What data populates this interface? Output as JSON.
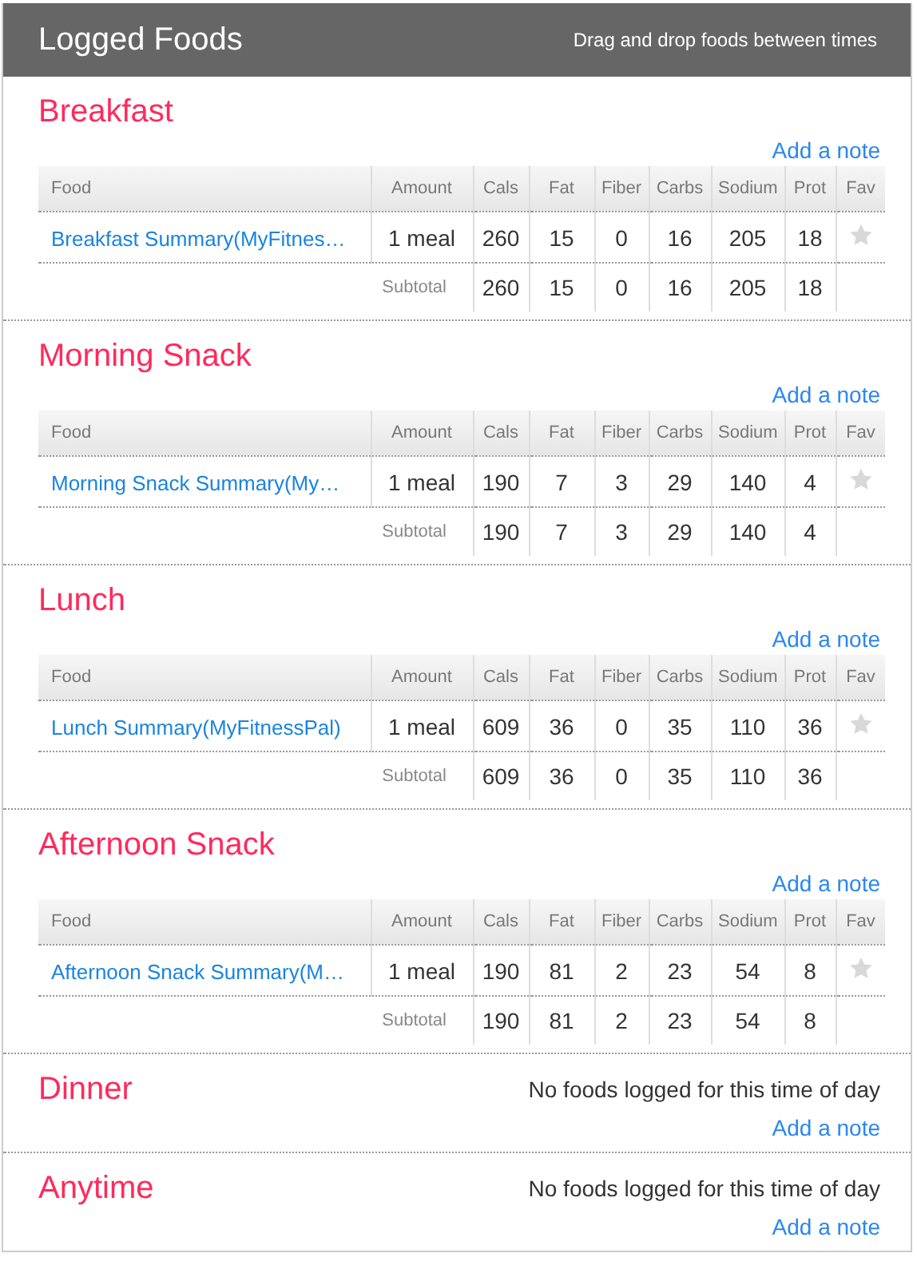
{
  "header": {
    "title": "Logged Foods",
    "hint": "Drag and drop foods between times"
  },
  "meals": [
    {
      "name": "Breakfast",
      "add_note": "Add a note",
      "columns": [
        "Food",
        "Amount",
        "Cals",
        "Fat",
        "Fiber",
        "Carbs",
        "Sodium",
        "Prot",
        "Fav"
      ],
      "rows": [
        {
          "food": "Breakfast Summary(MyFitnes…",
          "amount": "1 meal",
          "values": [
            "260",
            "15",
            "0",
            "16",
            "205",
            "18"
          ],
          "favorite": false
        }
      ],
      "subtotal": {
        "label": "Subtotal",
        "values": [
          "260",
          "15",
          "0",
          "16",
          "205",
          "18"
        ]
      }
    },
    {
      "name": "Morning Snack",
      "add_note": "Add a note",
      "columns": [
        "Food",
        "Amount",
        "Cals",
        "Fat",
        "Fiber",
        "Carbs",
        "Sodium",
        "Prot",
        "Fav"
      ],
      "rows": [
        {
          "food": "Morning Snack Summary(My…",
          "amount": "1 meal",
          "values": [
            "190",
            "7",
            "3",
            "29",
            "140",
            "4"
          ],
          "favorite": false
        }
      ],
      "subtotal": {
        "label": "Subtotal",
        "values": [
          "190",
          "7",
          "3",
          "29",
          "140",
          "4"
        ]
      }
    },
    {
      "name": "Lunch",
      "add_note": "Add a note",
      "columns": [
        "Food",
        "Amount",
        "Cals",
        "Fat",
        "Fiber",
        "Carbs",
        "Sodium",
        "Prot",
        "Fav"
      ],
      "rows": [
        {
          "food": "Lunch Summary(MyFitnessPal)",
          "amount": "1 meal",
          "values": [
            "609",
            "36",
            "0",
            "35",
            "110",
            "36"
          ],
          "favorite": false
        }
      ],
      "subtotal": {
        "label": "Subtotal",
        "values": [
          "609",
          "36",
          "0",
          "35",
          "110",
          "36"
        ]
      }
    },
    {
      "name": "Afternoon Snack",
      "add_note": "Add a note",
      "columns": [
        "Food",
        "Amount",
        "Cals",
        "Fat",
        "Fiber",
        "Carbs",
        "Sodium",
        "Prot",
        "Fav"
      ],
      "rows": [
        {
          "food": "Afternoon Snack Summary(M…",
          "amount": "1 meal",
          "values": [
            "190",
            "81",
            "2",
            "23",
            "54",
            "8"
          ],
          "favorite": false
        }
      ],
      "subtotal": {
        "label": "Subtotal",
        "values": [
          "190",
          "81",
          "2",
          "23",
          "54",
          "8"
        ]
      }
    },
    {
      "name": "Dinner",
      "add_note": "Add a note",
      "message": "No foods logged for this time of day"
    },
    {
      "name": "Anytime",
      "add_note": "Add a note",
      "message": "No foods logged for this time of day"
    }
  ]
}
